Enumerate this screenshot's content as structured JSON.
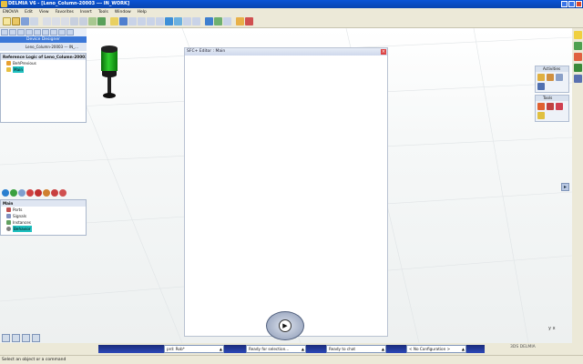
{
  "window": {
    "title": "DELMIA V6 - [Leno_Column-20003 --- IN_WORK]"
  },
  "menu": [
    "ENOVIA",
    "Edit",
    "View",
    "Favorites",
    "Insert",
    "Tools",
    "Window",
    "Help"
  ],
  "left_panel": {
    "designer_label": "Device Designer",
    "tab_label": "Leno_Column-20003 --- IN_...",
    "reference_title": "Reference Logic of Leno_Column-20003 --- IN_WORK",
    "reference_items": [
      {
        "label": "BehPrevious"
      },
      {
        "label": "Main"
      }
    ],
    "main_title": "Main",
    "main_items": [
      {
        "label": "Ports"
      },
      {
        "label": "Signals"
      },
      {
        "label": "Instances"
      },
      {
        "label": "Behavior"
      }
    ]
  },
  "sfc_editor": {
    "title": "SFC+ Editor : Main"
  },
  "right_panels": {
    "activities_label": "Activities",
    "tools_label": "Tools"
  },
  "taskbar": {
    "product": "prd: Rob*",
    "selection": "Ready for selection...",
    "chat": "Ready to chat",
    "configuration": "< No Configuration >",
    "logo_text": "3DS DELMIA"
  },
  "status": {
    "message": "Select an object or a command"
  },
  "axes": {
    "y": "y",
    "x": "x"
  },
  "colors": {
    "title_bar": "#0a54d6",
    "designer_bar": "#3c78d8",
    "highlight": "#20c0c0",
    "tower_green": "#2fcf2f",
    "chrome": "#ece9d8"
  }
}
